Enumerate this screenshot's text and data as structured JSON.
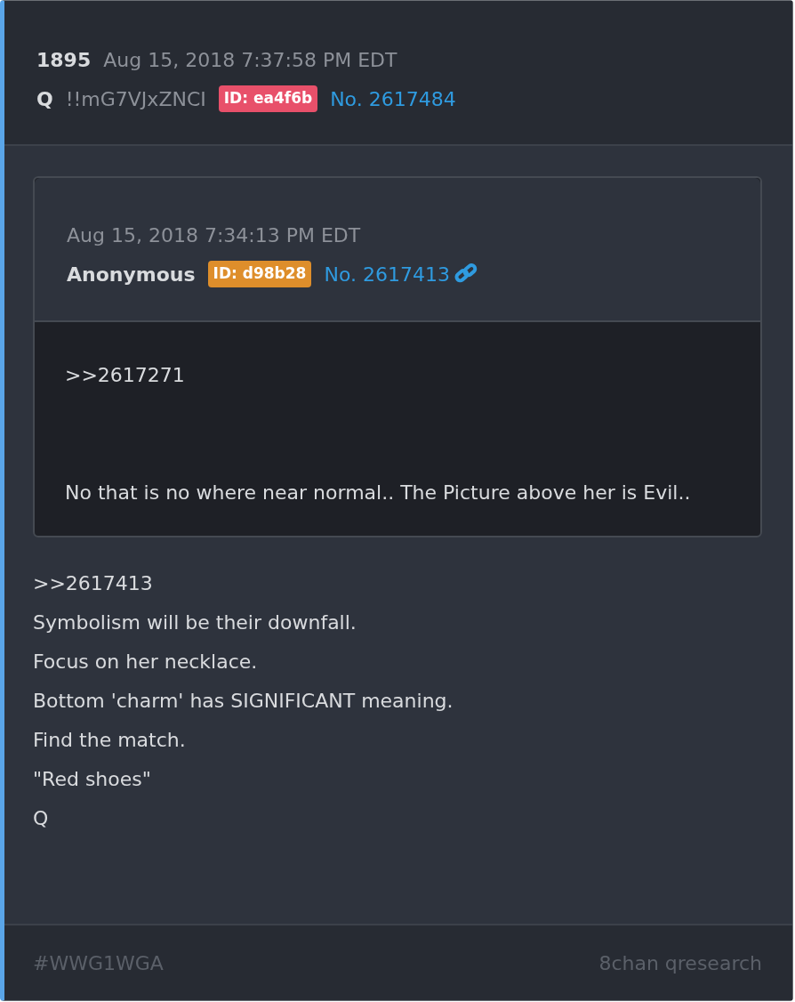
{
  "post": {
    "number": "1895",
    "date": "Aug 15, 2018 7:37:58 PM EDT",
    "author": "Q",
    "tripcode": "!!mG7VJxZNCI",
    "id_badge": {
      "text": "ID: ea4f6b",
      "color": "#e8506a"
    },
    "post_link": "No. 2617484"
  },
  "quote": {
    "date": "Aug 15, 2018 7:34:13 PM EDT",
    "author": "Anonymous",
    "id_badge": {
      "text": "ID: d98b28",
      "color": "#de8e2b"
    },
    "post_link": "No. 2617413",
    "paragraphs": [
      ">>2617271",
      "No that is no where near normal.. The Picture above her is Evil.."
    ]
  },
  "lines": [
    ">>2617413",
    "Symbolism will be their downfall.",
    "Focus on her necklace.",
    "Bottom 'charm' has SIGNIFICANT meaning.",
    "Find the match.",
    "\"Red shoes\"",
    "Q"
  ],
  "footer": {
    "hashtag": "#WWG1WGA",
    "source": "8chan qresearch"
  }
}
